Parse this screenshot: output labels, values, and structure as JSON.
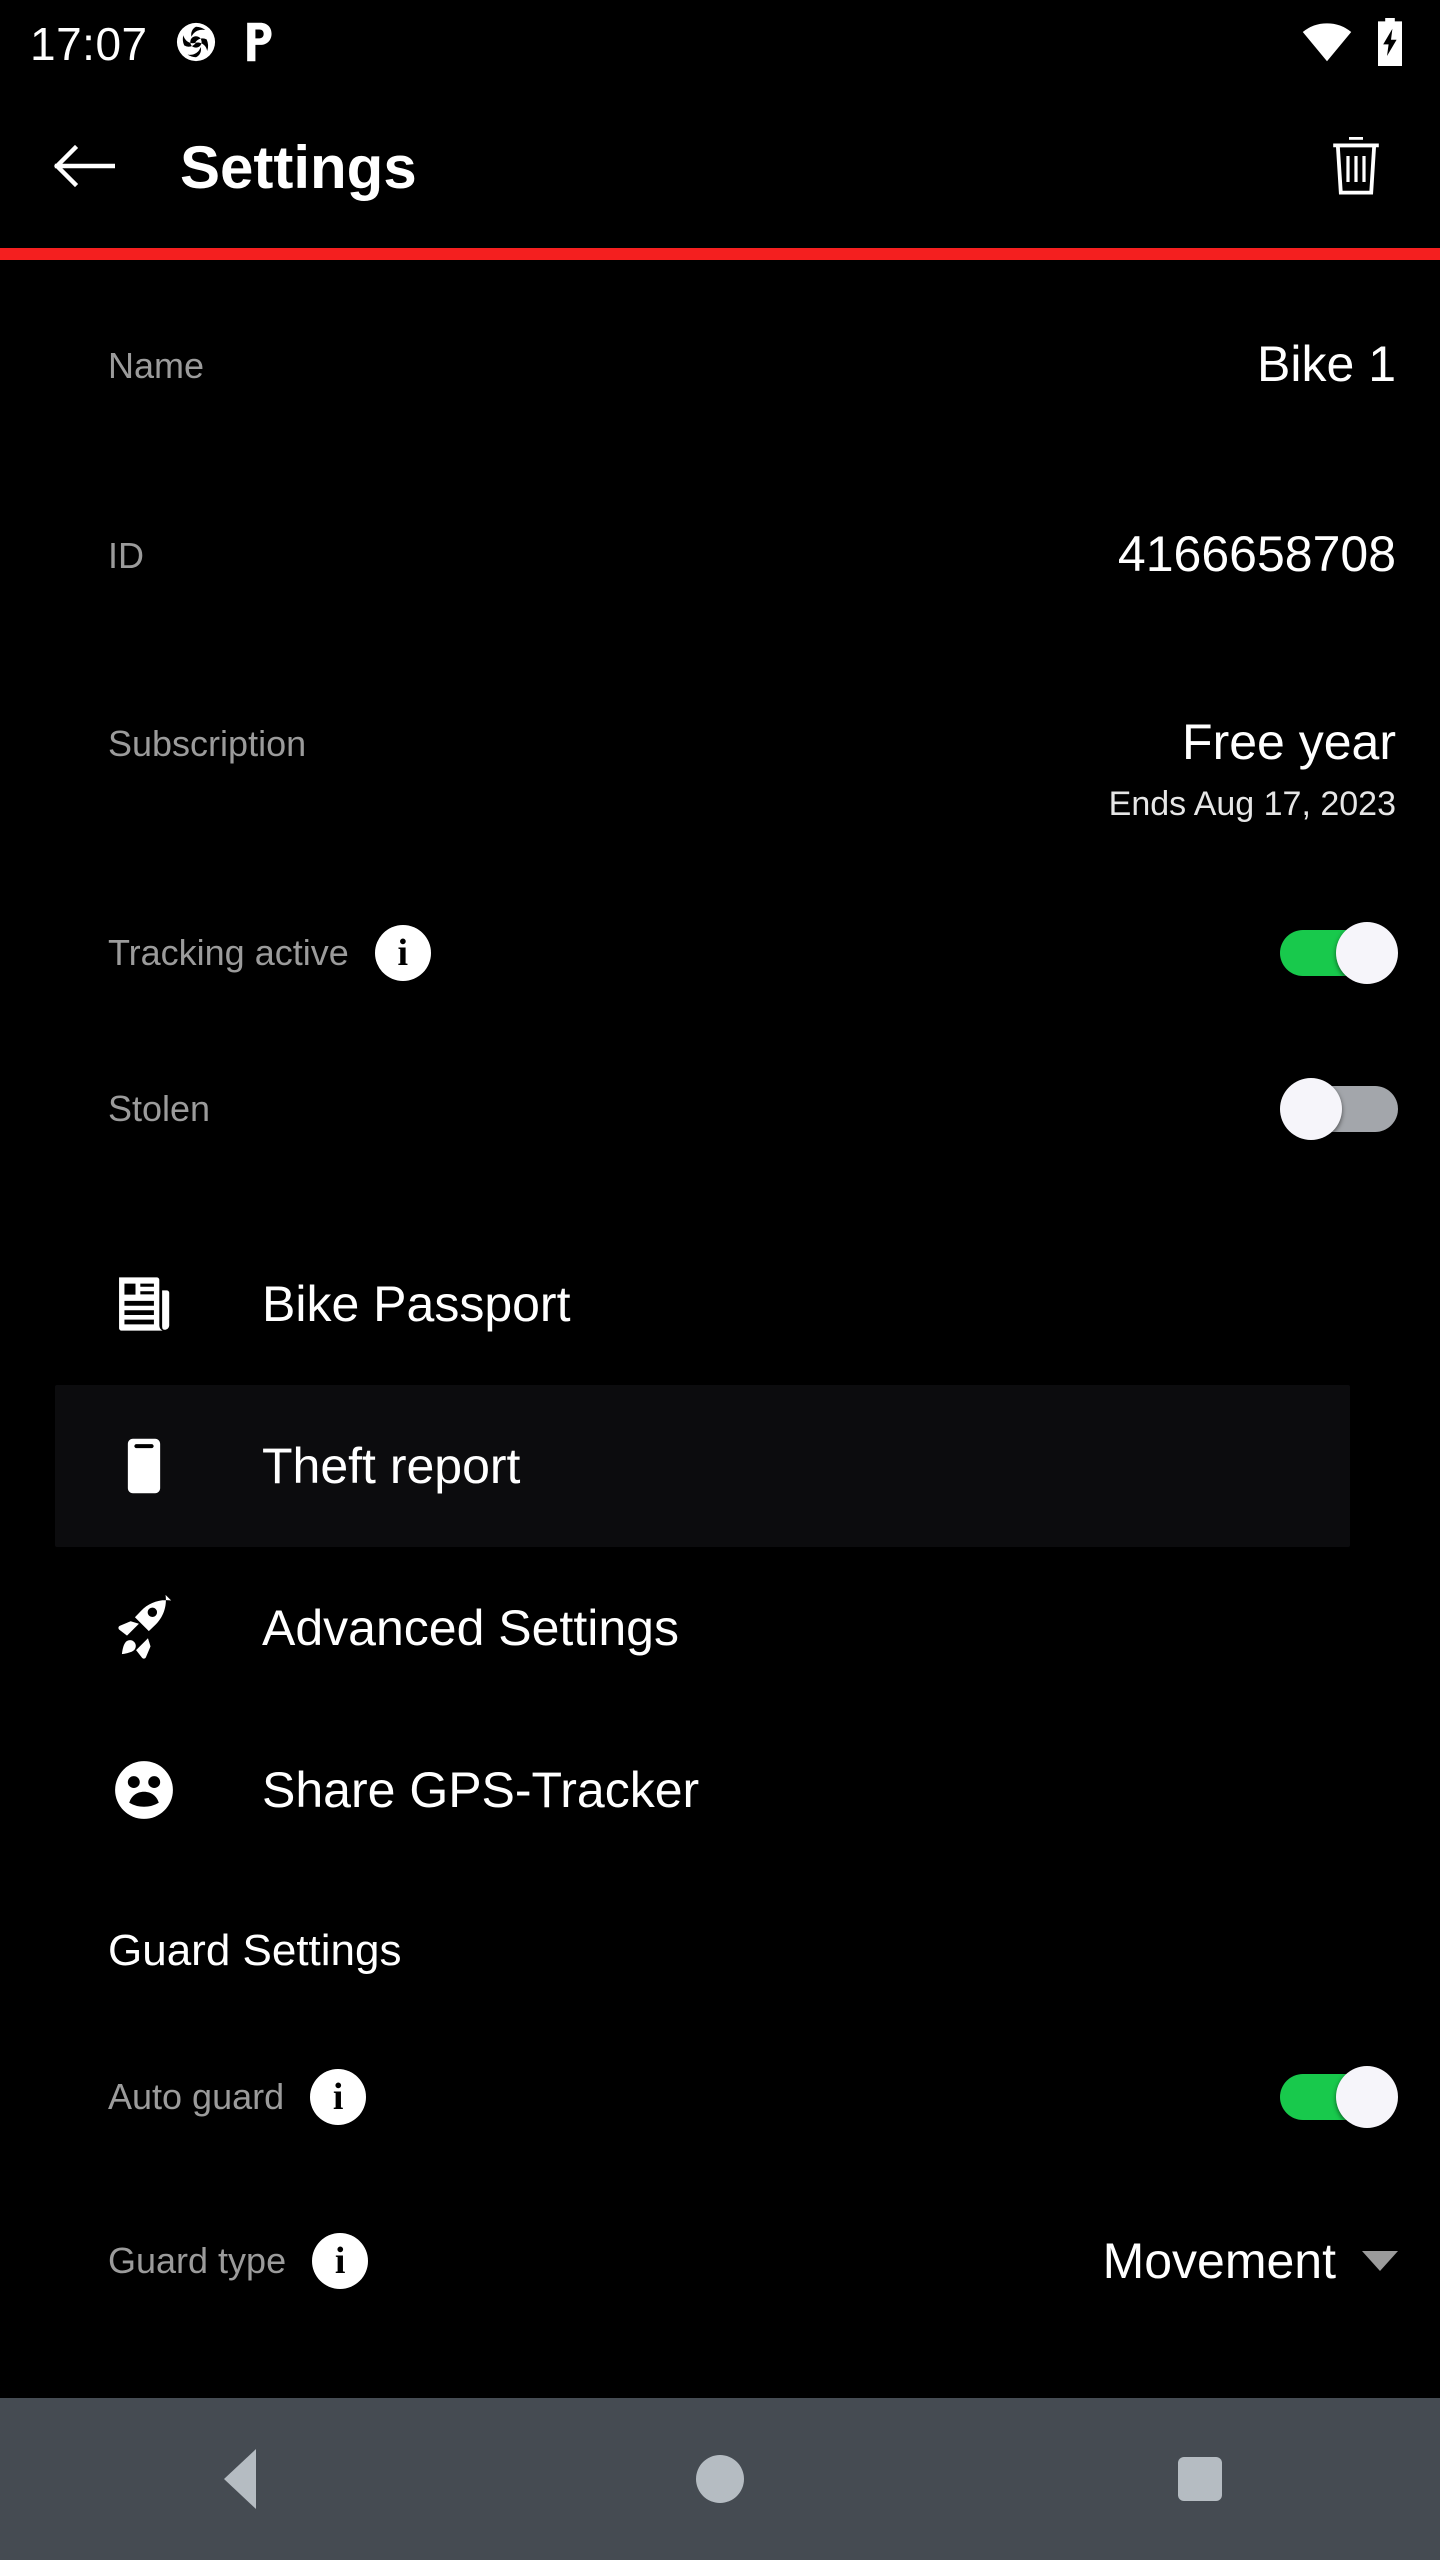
{
  "statusbar": {
    "clock": "17:07",
    "notification_icons": [
      "aperture-logo-icon",
      "letter-p-app-icon"
    ],
    "system_icons": [
      "wifi-icon",
      "battery-charging-icon"
    ]
  },
  "appbar": {
    "back_icon": "arrow-left-icon",
    "title": "Settings",
    "delete_icon": "trash-icon",
    "accent_color": "#f41f1f"
  },
  "details": [
    {
      "label": "Name",
      "value": "Bike 1",
      "sub": ""
    },
    {
      "label": "ID",
      "value": "4166658708",
      "sub": ""
    },
    {
      "label": "Subscription",
      "value": "Free year",
      "sub": "Ends Aug 17, 2023"
    }
  ],
  "toggles": {
    "tracking": {
      "label": "Tracking active",
      "info_icon": "info-icon",
      "state": "on",
      "on_color": "#18c94c"
    },
    "stolen": {
      "label": "Stolen",
      "state": "off",
      "off_color": "#a3a6ab"
    }
  },
  "menu": [
    {
      "label": "Bike Passport",
      "icon": "newspaper-icon",
      "selected": false
    },
    {
      "label": "Theft report",
      "icon": "clipboard-icon",
      "selected": true
    },
    {
      "label": "Advanced Settings",
      "icon": "rocket-icon",
      "selected": false
    },
    {
      "label": "Share GPS-Tracker",
      "icon": "group-icon",
      "selected": false
    }
  ],
  "guard": {
    "section_title": "Guard Settings",
    "auto_guard": {
      "label": "Auto guard",
      "info_icon": "info-icon",
      "state": "on",
      "on_color": "#18c94c"
    },
    "guard_type": {
      "label": "Guard type",
      "info_icon": "info-icon",
      "value": "Movement",
      "caret_icon": "chevron-down-icon"
    }
  },
  "navbar": {
    "back": "nav-back-icon",
    "home": "nav-home-icon",
    "recents": "nav-recents-icon",
    "background": "#454b52"
  }
}
